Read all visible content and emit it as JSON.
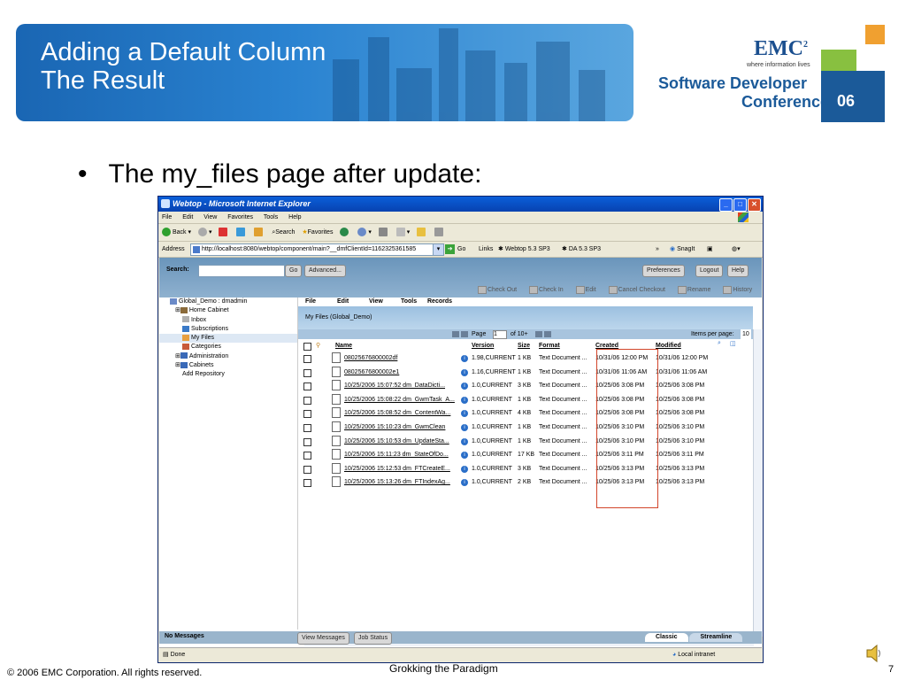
{
  "slide": {
    "title_line1": "Adding a Default Column",
    "title_line2": "The Result",
    "bullet_symbol": "•",
    "bullet": "The my_files page after update:",
    "footer_copyright": "© 2006 EMC Corporation. All rights reserved.",
    "footer_center": "Grokking the Paradigm",
    "page_number": "7"
  },
  "logo": {
    "brand": "EMC",
    "brand_sup": "2",
    "tagline": "where information lives",
    "line1": "Software Developer",
    "line2": "Conference",
    "year": "06"
  },
  "browser": {
    "title": "Webtop - Microsoft Internet Explorer",
    "menus": [
      "File",
      "Edit",
      "View",
      "Favorites",
      "Tools",
      "Help"
    ],
    "toolbar": {
      "back": "Back",
      "search": "Search",
      "favorites": "Favorites"
    },
    "address_label": "Address",
    "address_value": "http://localhost:8080/webtop/component/main?__dmfClientId=1162325361585",
    "go_label": "Go",
    "links_label": "Links",
    "link1": "Webtop 5.3 SP3",
    "link2": "DA 5.3 SP3",
    "snagit": "SnagIt",
    "status_text": "Done",
    "zone": "Local intranet"
  },
  "app": {
    "search_label": "Search:",
    "search_go": "Go",
    "advanced": "Advanced...",
    "preferences": "Preferences",
    "logout": "Logout",
    "help": "Help",
    "actions": [
      "Check Out",
      "Check In",
      "Edit",
      "Cancel Checkout",
      "Rename",
      "History"
    ],
    "menu": [
      "File",
      "Edit",
      "View",
      "Tools",
      "Records"
    ],
    "tree": [
      "Global_Demo : dmadmin",
      "Home Cabinet",
      "Inbox",
      "Subscriptions",
      "My Files",
      "Categories",
      "Administration",
      "Cabinets",
      "Add Repository"
    ],
    "breadcrumb": "My Files (Global_Demo)",
    "pager": {
      "page_label": "Page",
      "page_value": "1",
      "of_label": "of 10+",
      "items_label": "Items per page:",
      "items_value": "10"
    },
    "columns": [
      "Name",
      "Version",
      "Size",
      "Format",
      "Created",
      "Modified"
    ],
    "rows": [
      {
        "name": "08025676800002df",
        "version": "1.98,CURRENT",
        "size": "1 KB",
        "format": "Text Document ...",
        "created": "10/31/06 12:00 PM",
        "modified": "10/31/06 12:00 PM"
      },
      {
        "name": "08025676800002e1",
        "version": "1.16,CURRENT",
        "size": "1 KB",
        "format": "Text Document ...",
        "created": "10/31/06 11:06 AM",
        "modified": "10/31/06 11:06 AM"
      },
      {
        "name": "10/25/2006 15:07:52 dm_DataDicti...",
        "version": "1.0,CURRENT",
        "size": "3 KB",
        "format": "Text Document ...",
        "created": "10/25/06 3:08 PM",
        "modified": "10/25/06 3:08 PM"
      },
      {
        "name": "10/25/2006 15:08:22 dm_GwmTask_A...",
        "version": "1.0,CURRENT",
        "size": "1 KB",
        "format": "Text Document ...",
        "created": "10/25/06 3:08 PM",
        "modified": "10/25/06 3:08 PM"
      },
      {
        "name": "10/25/2006 15:08:52 dm_ContentWa...",
        "version": "1.0,CURRENT",
        "size": "4 KB",
        "format": "Text Document ...",
        "created": "10/25/06 3:08 PM",
        "modified": "10/25/06 3:08 PM"
      },
      {
        "name": "10/25/2006 15:10:23 dm_GwmClean",
        "version": "1.0,CURRENT",
        "size": "1 KB",
        "format": "Text Document ...",
        "created": "10/25/06 3:10 PM",
        "modified": "10/25/06 3:10 PM"
      },
      {
        "name": "10/25/2006 15:10:53 dm_UpdateSta...",
        "version": "1.0,CURRENT",
        "size": "1 KB",
        "format": "Text Document ...",
        "created": "10/25/06 3:10 PM",
        "modified": "10/25/06 3:10 PM"
      },
      {
        "name": "10/25/2006 15:11:23 dm_StateOfDo...",
        "version": "1.0,CURRENT",
        "size": "17 KB",
        "format": "Text Document ...",
        "created": "10/25/06 3:11 PM",
        "modified": "10/25/06 3:11 PM"
      },
      {
        "name": "10/25/2006 15:12:53 dm_FTCreateE...",
        "version": "1.0,CURRENT",
        "size": "3 KB",
        "format": "Text Document ...",
        "created": "10/25/06 3:13 PM",
        "modified": "10/25/06 3:13 PM"
      },
      {
        "name": "10/25/2006 15:13:26 dm_FTIndexAg...",
        "version": "1.0,CURRENT",
        "size": "2 KB",
        "format": "Text Document ...",
        "created": "10/25/06 3:13 PM",
        "modified": "10/25/06 3:13 PM"
      }
    ],
    "no_messages": "No Messages",
    "view_messages": "View Messages",
    "job_status": "Job Status",
    "tab_classic": "Classic",
    "tab_streamline": "Streamline"
  },
  "colors": {
    "banner": "#1a66b3",
    "ie_title": "#0a5fd9",
    "highlight": "#d2452a"
  }
}
